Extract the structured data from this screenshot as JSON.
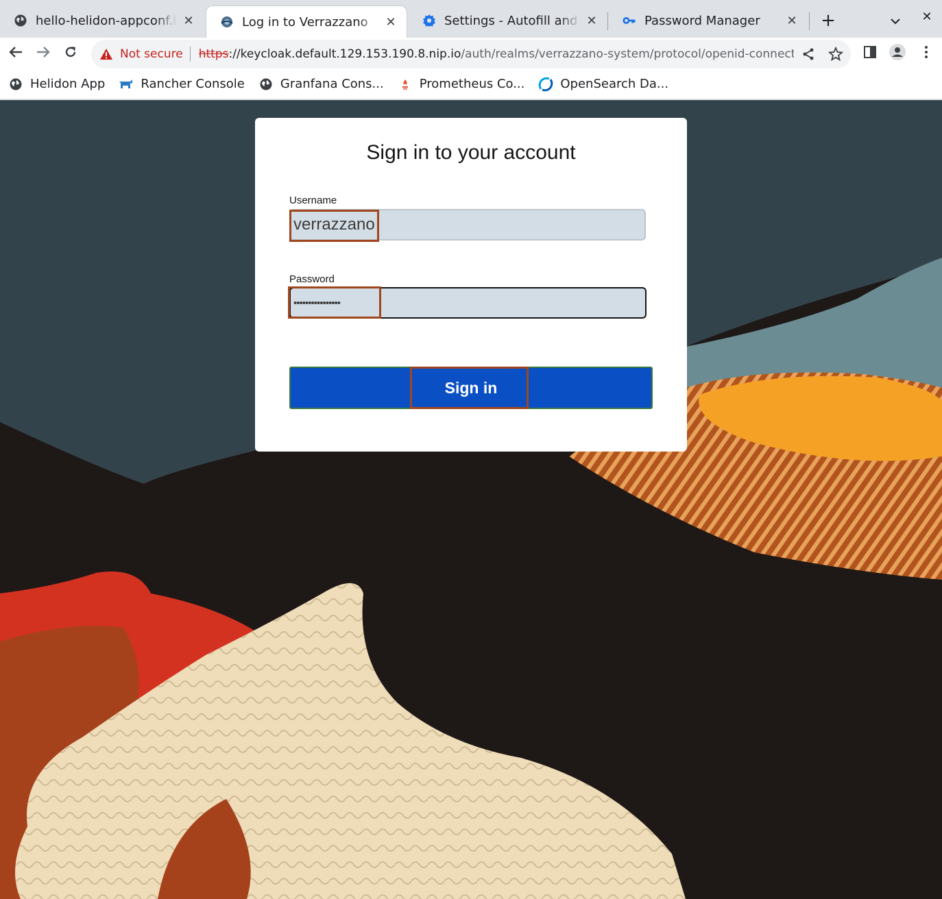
{
  "browser": {
    "tabs": [
      {
        "title": "hello-helidon-appconf.helidon",
        "icon": "globe-icon",
        "active": false
      },
      {
        "title": "Log in to Verrazzano",
        "icon": "verrazzano-icon",
        "active": true
      },
      {
        "title": "Settings - Autofill and passwords",
        "icon": "gear-icon",
        "active": false
      },
      {
        "title": "Password Manager",
        "icon": "key-icon",
        "active": false
      }
    ],
    "address": {
      "security_label": "Not secure",
      "scheme": "https",
      "host": "://keycloak.default.129.153.190.8.nip.io",
      "path": "/auth/realms/verrazzano-system/protocol/openid-connect/auth?cli..."
    },
    "bookmarks": [
      {
        "label": "Helidon App",
        "icon": "globe-icon"
      },
      {
        "label": "Rancher Console",
        "icon": "rancher-icon"
      },
      {
        "label": "Granfana Cons...",
        "icon": "globe-icon"
      },
      {
        "label": "Prometheus Co...",
        "icon": "prometheus-icon"
      },
      {
        "label": "OpenSearch Da...",
        "icon": "opensearch-icon"
      }
    ]
  },
  "login": {
    "title": "Sign in to your account",
    "username_label": "Username",
    "username_value": "verrazzano",
    "password_label": "Password",
    "password_value": "••••••••••••••••",
    "submit_label": "Sign in"
  },
  "colors": {
    "accent": "#0a50c4",
    "highlight": "#a0461f",
    "insecure": "#c5221f"
  }
}
